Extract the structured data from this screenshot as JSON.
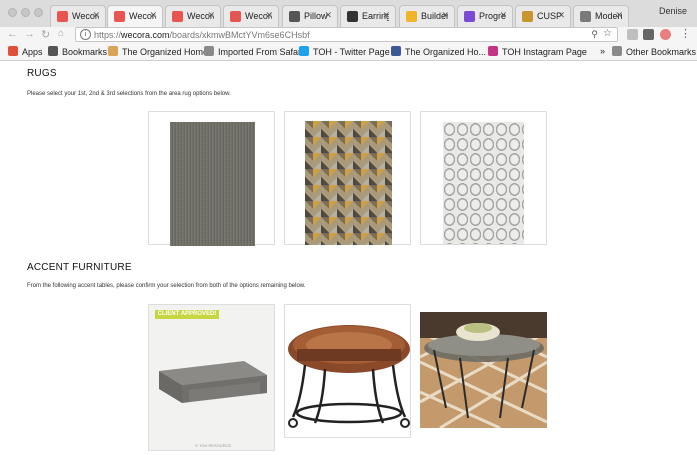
{
  "browser": {
    "tabs": [
      {
        "title": "Wecora",
        "favicon_color": "#e8544f"
      },
      {
        "title": "Wecora",
        "favicon_color": "#e8544f"
      },
      {
        "title": "Wecora",
        "favicon_color": "#e8544f"
      },
      {
        "title": "Wecora",
        "favicon_color": "#e8544f"
      },
      {
        "title": "Pillow",
        "favicon_color": "#555555"
      },
      {
        "title": "Earring",
        "favicon_color": "#333333"
      },
      {
        "title": "Builder",
        "favicon_color": "#f0b429"
      },
      {
        "title": "Progre",
        "favicon_color": "#7b4bd6"
      },
      {
        "title": "CUSP",
        "favicon_color": "#c8962c"
      },
      {
        "title": "Modern",
        "favicon_color": "#7a7a7a"
      }
    ],
    "profile_name": "Denise",
    "url_prefix": "https://",
    "url_host": "wecora.com",
    "url_path": "/boards/xkmwBMctYVm6se6CHsbf",
    "bookmarks": [
      {
        "label": "Apps",
        "icon_color": "#e0513b"
      },
      {
        "label": "Bookmarks",
        "icon_color": "#555555"
      },
      {
        "label": "The Organized Home",
        "icon_color": "#d8a35a"
      },
      {
        "label": "Imported From Safari",
        "icon_color": "#8a8a8a"
      },
      {
        "label": "TOH - Twitter Page",
        "icon_color": "#1da1f2"
      },
      {
        "label": "The Organized Ho...",
        "icon_color": "#3b5998"
      },
      {
        "label": "TOH Instagram Page",
        "icon_color": "#c13584"
      }
    ],
    "overflow": "»",
    "other_bookmarks": "Other Bookmarks"
  },
  "rugs": {
    "title": "RUGS",
    "description": "Please select your 1st, 2nd & 3rd selections from the area rug options below."
  },
  "furniture": {
    "title": "ACCENT FURNITURE",
    "description": "From the following accent tables, please confirm your selection from both of the options remaining below.",
    "badge": "CLIENT APPROVED!",
    "credit": "© TOH RESOURCE"
  },
  "colors": {
    "badge_bg": "#c6d641"
  }
}
